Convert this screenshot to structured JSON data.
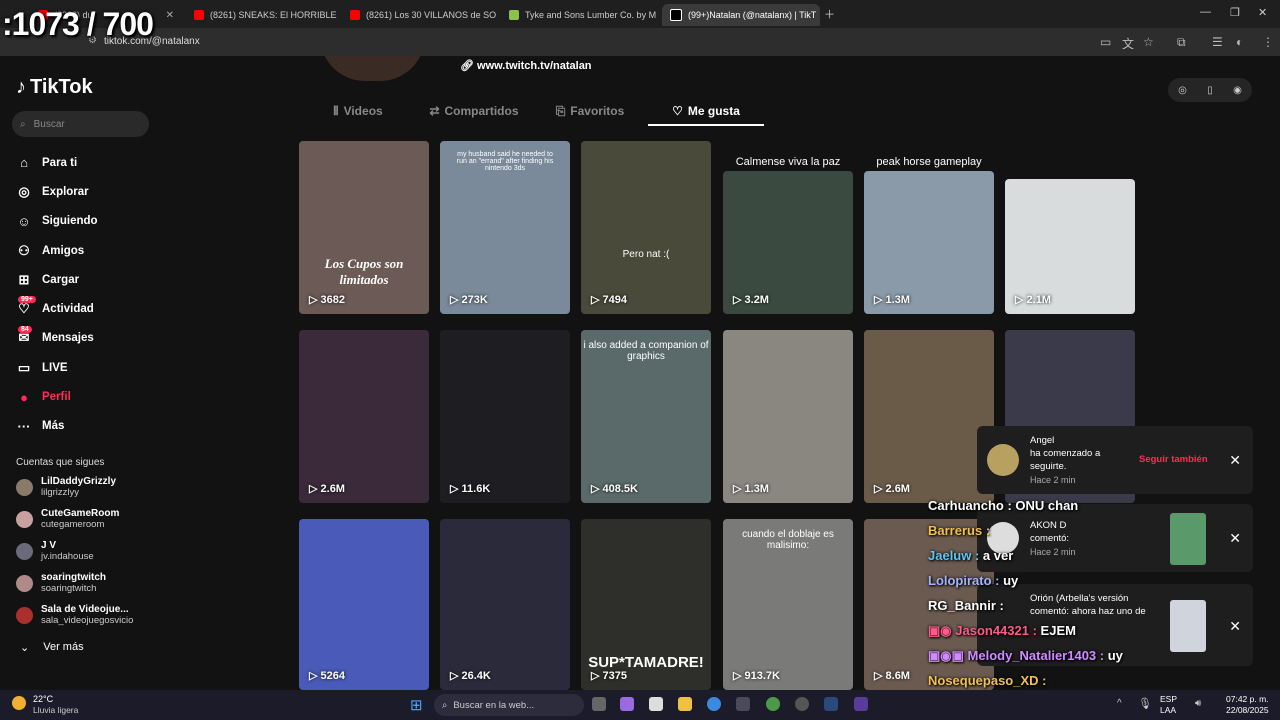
{
  "overlay_counter": ":1073 / 700",
  "browser": {
    "tabs": [
      {
        "label": "(8263) du",
        "color": "#ff0000"
      },
      {
        "label": "(8261) SNEAKS: El HORRIBLE P",
        "color": "#ff0000"
      },
      {
        "label": "(8261) Los 30 VILLANOS de SO",
        "color": "#ff0000"
      },
      {
        "label": "Tyke and Sons Lumber Co. by M",
        "color": "#8bc34a"
      },
      {
        "label": "(99+)Natalan (@natalanx) | TikT",
        "color": "#000000"
      }
    ],
    "url": "tiktok.com/@natalanx"
  },
  "sidebar": {
    "logo": "TikTok",
    "search_placeholder": "Buscar",
    "nav": [
      {
        "label": "Para ti",
        "icon": "home-icon"
      },
      {
        "label": "Explorar",
        "icon": "compass-icon"
      },
      {
        "label": "Siguiendo",
        "icon": "following-icon"
      },
      {
        "label": "Amigos",
        "icon": "friends-icon"
      },
      {
        "label": "Cargar",
        "icon": "upload-icon"
      },
      {
        "label": "Actividad",
        "icon": "activity-icon",
        "badge": "99+"
      },
      {
        "label": "Mensajes",
        "icon": "messages-icon",
        "badge": "84"
      },
      {
        "label": "LIVE",
        "icon": "live-icon"
      },
      {
        "label": "Perfil",
        "icon": "profile-icon"
      },
      {
        "label": "Más",
        "icon": "more-icon"
      }
    ],
    "following_title": "Cuentas que sigues",
    "accounts": [
      {
        "name": "LilDaddyGrizzly",
        "handle": "lilgrizzlyy"
      },
      {
        "name": "CuteGameRoom",
        "handle": "cutegameroom"
      },
      {
        "name": "J V",
        "handle": "jv.indahouse"
      },
      {
        "name": "soaringtwitch",
        "handle": "soaringtwitch"
      },
      {
        "name": "Sala de Videojue...",
        "handle": "sala_videojuegosvicio"
      }
    ],
    "see_more": "Ver más"
  },
  "profile": {
    "link": "www.twitch.tv/natalan",
    "tabs": [
      "Videos",
      "Compartidos",
      "Favoritos",
      "Me gusta"
    ],
    "active_tab": "Me gusta"
  },
  "videos": [
    {
      "views": "3682",
      "caption": "Los Cupos son limitados",
      "bg": "#6b5a55"
    },
    {
      "views": "273K",
      "caption": "my husband said he needed to run an \"errand\" after finding his nintendo 3ds",
      "bg": "#7a8a9a"
    },
    {
      "views": "7494",
      "caption": "Pero nat :(",
      "bg": "#4a4a3a"
    },
    {
      "views": "3.2M",
      "caption": "Calmense viva la paz",
      "bg": "#3a4a40"
    },
    {
      "views": "1.3M",
      "caption": "peak horse gameplay",
      "bg": "#8a9aa8"
    },
    {
      "views": "2.1M",
      "caption": "",
      "bg": "#d8dcdc"
    },
    {
      "views": "2.6M",
      "caption": "",
      "bg": "#3a2a3a"
    },
    {
      "views": "11.6K",
      "caption": "",
      "bg": "#1e1e22"
    },
    {
      "views": "408.5K",
      "caption": "i also added a companion of graphics",
      "bg": "#5a6a6a"
    },
    {
      "views": "1.3M",
      "caption": "",
      "bg": "#8a8680"
    },
    {
      "views": "2.6M",
      "caption": "",
      "bg": "#6a5a48"
    },
    {
      "views": "",
      "caption": "",
      "bg": "#3a3a4a"
    },
    {
      "views": "5264",
      "caption": "",
      "bg": "#4a5ab8"
    },
    {
      "views": "26.4K",
      "caption": "",
      "bg": "#2a2a3a"
    },
    {
      "views": "7375",
      "caption": "SUP*TAMADRE!",
      "bg": "#2e2e2a"
    },
    {
      "views": "913.7K",
      "caption": "cuando el doblaje es malisimo:",
      "bg": "#7a7a78"
    },
    {
      "views": "8.6M",
      "caption": "",
      "bg": "#6a5a50"
    }
  ],
  "notifications": [
    {
      "name": "Angel",
      "text": "ha comenzado a seguirte.",
      "time": "Hace 2 min",
      "action": "Seguir también"
    },
    {
      "name": "AKON D",
      "text": "comentó:",
      "time": "Hace 2 min"
    },
    {
      "name": "Orión (Arbella's versión",
      "text": "comentó: ahora haz uno de",
      "time": ""
    }
  ],
  "chat": [
    {
      "user": "Carhuancho",
      "msg": "ONU chan",
      "color": "#ffffff"
    },
    {
      "user": "Barrerus",
      "msg": "",
      "color": "#f2c14e"
    },
    {
      "user": "Jaeluw",
      "msg": "a ver",
      "color": "#5bc8f5"
    },
    {
      "user": "Lolopirato",
      "msg": "uy",
      "color": "#a0b4ff"
    },
    {
      "user": "RG_Bannir",
      "msg": "",
      "color": "#ffffff"
    },
    {
      "user": "Jason44321",
      "msg": "EJEM",
      "color": "#ff5a8a"
    },
    {
      "user": "Melody_Natalier1403",
      "msg": "uy",
      "color": "#d08aff"
    },
    {
      "user": "Nosequepaso_XD",
      "msg": "",
      "color": "#f2c14e"
    }
  ],
  "taskbar": {
    "weather_temp": "22°C",
    "weather_desc": "Lluvia ligera",
    "search": "Buscar en la web...",
    "lang1": "ESP",
    "lang2": "LAA",
    "time": "07:42 p. m.",
    "date": "22/08/2025"
  }
}
